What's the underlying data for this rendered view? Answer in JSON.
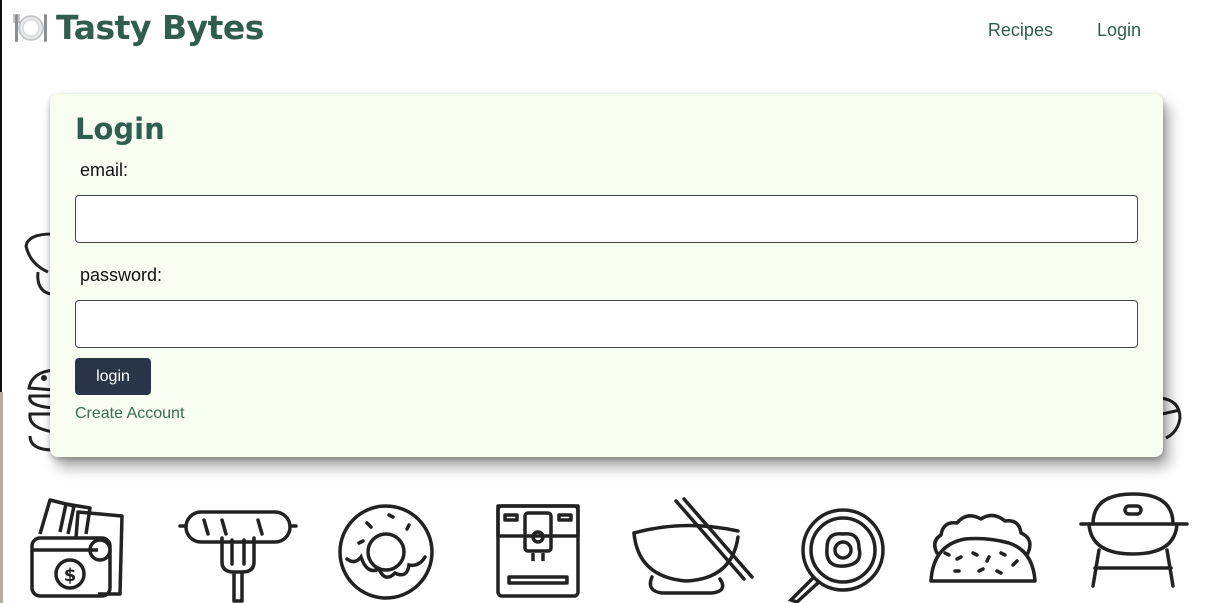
{
  "header": {
    "brand_icon": "plate-cutlery-icon",
    "brand_title": "Tasty Bytes",
    "nav": [
      {
        "label": "Recipes"
      },
      {
        "label": "Login"
      }
    ]
  },
  "login_form": {
    "title": "Login",
    "email_label": "email:",
    "email_value": "",
    "password_label": "password:",
    "password_value": "",
    "submit_label": "login",
    "create_account_label": "Create Account"
  },
  "background_icons": [
    "money-icon",
    "sausage-fork-icon",
    "donut-icon",
    "coffee-machine-icon",
    "bowl-chopsticks-icon",
    "frying-pan-egg-icon",
    "taco-icon",
    "grill-icon"
  ],
  "colors": {
    "brand": "#2f5e4e",
    "card_background": "#f8fdf1",
    "button": "#2b3548",
    "link": "#3b6b56"
  }
}
